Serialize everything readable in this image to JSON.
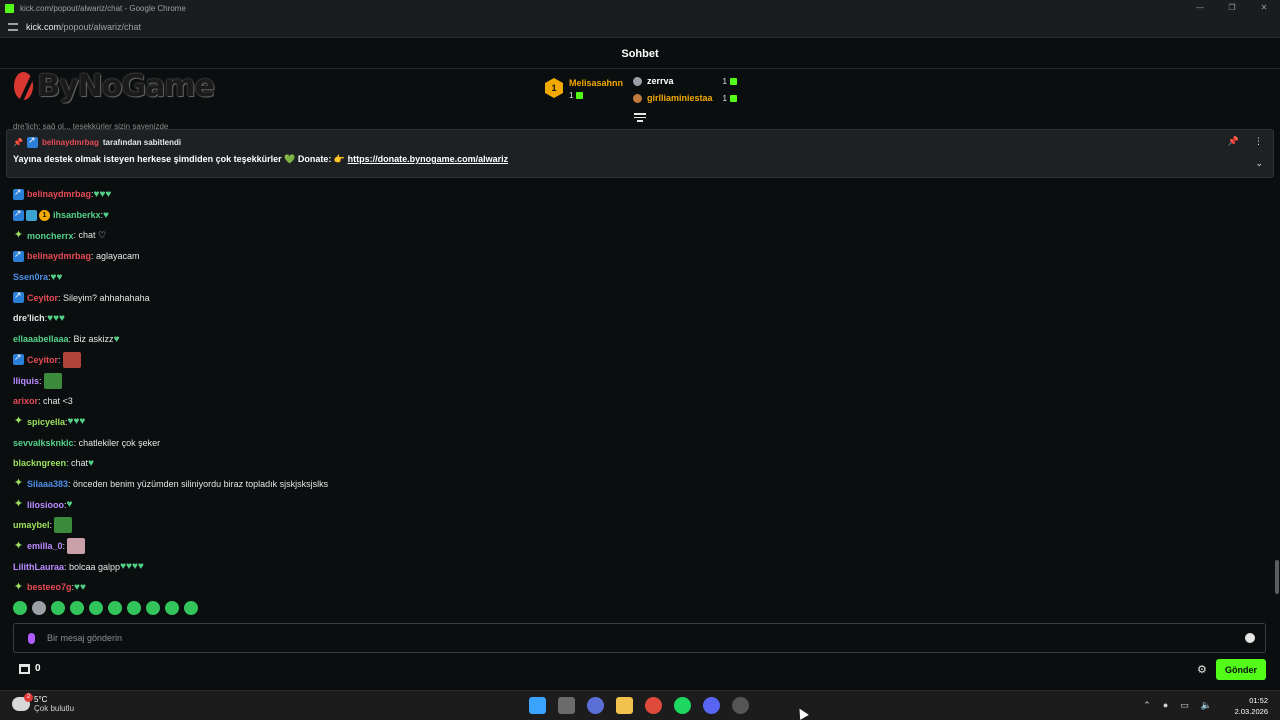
{
  "browser": {
    "window_title": "kick.com/popout/alwariz/chat - Google Chrome",
    "url_host": "kick.com",
    "url_path": "/popout/alwariz/chat"
  },
  "chat": {
    "header_title": "Sohbet",
    "logo_text": "ByNoGame",
    "faded_text": "dre'lich: sağ ol... teşekkürler sizin sayenizde",
    "leaderboard": {
      "first": {
        "rank": "1",
        "name": "Melisasahnn",
        "count": "1"
      },
      "others": [
        {
          "name": "zerrva",
          "count": "1",
          "color": "#ffffff"
        },
        {
          "name": "girlliaminiestaa",
          "count": "1",
          "color": "#f2a900"
        }
      ]
    },
    "pinned": {
      "by_user": "belinaydmrbag",
      "by_suffix": "tarafından sabitlendi",
      "message_prefix": "Yayına destek olmak isteyen herkese şimdiden çok teşekkürler 💚 Donate: 👉",
      "link": "https://donate.bynogame.com/alwariz"
    },
    "messages": [
      {
        "badges": [
          "mod"
        ],
        "user": "belinaydmrbag",
        "color": "#e64a55",
        "text": ":",
        "hearts": 3
      },
      {
        "badges": [
          "mod",
          "gift",
          "sub"
        ],
        "user": "ihsanberkx",
        "color": "#53d28a",
        "text": ":",
        "hearts": 1
      },
      {
        "badges": [
          "star"
        ],
        "user": "moncherrx",
        "color": "#53d28a",
        "text": ": chat ♡",
        "hearts": 0
      },
      {
        "badges": [
          "mod"
        ],
        "user": "belinaydmrbag",
        "color": "#e64a55",
        "text": ": aglayacam",
        "hearts": 0
      },
      {
        "badges": [],
        "user": "Ssen0ra",
        "color": "#4e8fe8",
        "text": ":",
        "hearts": 2
      },
      {
        "badges": [
          "mod"
        ],
        "user": "Ceyitor",
        "color": "#e64a55",
        "text": ": Sileyim? ahhahahaha",
        "hearts": 0
      },
      {
        "badges": [],
        "user": "dre'lich",
        "color": "#e6e6e6",
        "text": ":",
        "hearts": 3
      },
      {
        "badges": [],
        "user": "ellaaabellaaa",
        "color": "#53d28a",
        "text": ": Biz askizz",
        "hearts": 1
      },
      {
        "badges": [
          "mod"
        ],
        "user": "Ceyitor",
        "color": "#e64a55",
        "text": ":",
        "hearts": 0,
        "emote": "#b0443a"
      },
      {
        "badges": [],
        "user": "lliquis",
        "color": "#b98bff",
        "text": ":",
        "hearts": 0,
        "emote": "#3c8a3c"
      },
      {
        "badges": [],
        "user": "arixor",
        "color": "#e64a55",
        "text": ": chat <3",
        "hearts": 0
      },
      {
        "badges": [
          "star"
        ],
        "user": "spicyella",
        "color": "#9be15d",
        "text": ":",
        "hearts": 3
      },
      {
        "badges": [],
        "user": "sevvalksknklc",
        "color": "#53d28a",
        "text": ": chatlekiler çok şeker",
        "hearts": 0
      },
      {
        "badges": [],
        "user": "blackngreen",
        "color": "#9be15d",
        "text": ": chat",
        "hearts": 1
      },
      {
        "badges": [
          "star"
        ],
        "user": "Silaaa383",
        "color": "#4e8fe8",
        "text": ": önceden benim yüzümden siliniyordu biraz topladık sjskjsksjslks",
        "hearts": 0
      },
      {
        "badges": [
          "star"
        ],
        "user": "lilosiooo",
        "color": "#b98bff",
        "text": ":",
        "hearts": 1
      },
      {
        "badges": [],
        "user": "umaybel",
        "color": "#9be15d",
        "text": ":",
        "hearts": 0,
        "emote": "#3c8a3c"
      },
      {
        "badges": [
          "star"
        ],
        "user": "emilla_0",
        "color": "#b98bff",
        "text": ":",
        "hearts": 0,
        "emote": "#c9a0a8"
      },
      {
        "badges": [],
        "user": "LilithLauraa",
        "color": "#b98bff",
        "text": ": bolcaa galpp",
        "hearts": 4
      },
      {
        "badges": [
          "star"
        ],
        "user": "besteeo7g",
        "color": "#e64a55",
        "text": ":",
        "hearts": 2
      }
    ],
    "input_placeholder": "Bir mesaj gönderin",
    "kicks_count": "0",
    "send_label": "Gönder"
  },
  "taskbar": {
    "weather_temp": "5°C",
    "weather_desc": "Çok bulutlu",
    "time": "01:52",
    "date": "2.03.2026"
  },
  "colors": {
    "accent": "#53fc18",
    "background": "#0b0e0f",
    "pinned_bg": "#1e2124"
  }
}
